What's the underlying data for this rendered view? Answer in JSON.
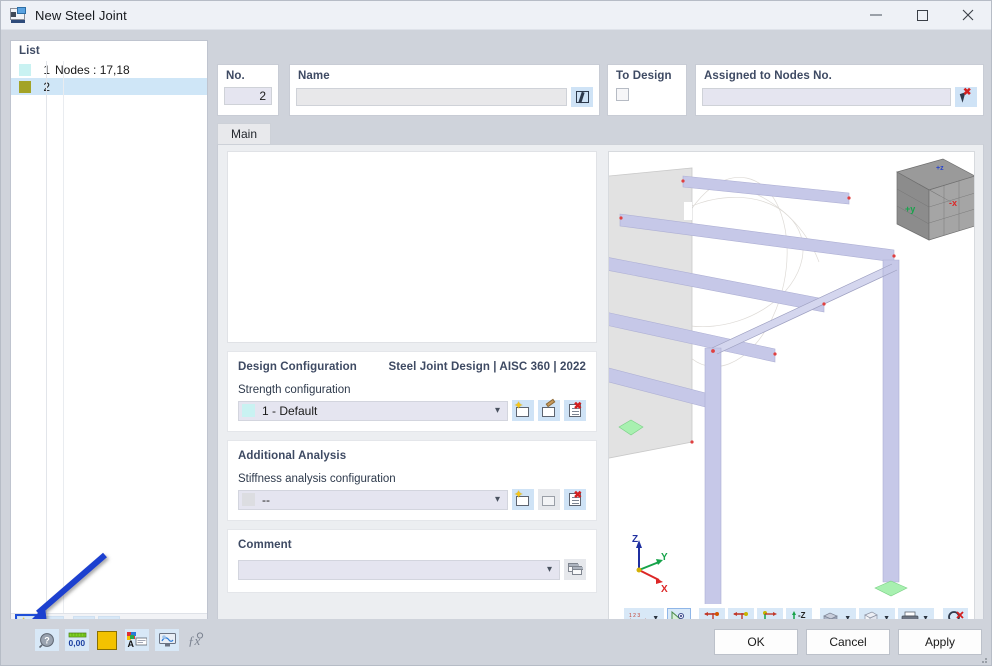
{
  "window": {
    "title": "New Steel Joint",
    "icon": "steel-joint-icon",
    "controls": {
      "minimize": "–",
      "maximize": "☐",
      "close": "✕"
    }
  },
  "list_panel": {
    "header": "List",
    "rows": [
      {
        "index": "1",
        "label": "Nodes : 17,18",
        "color": "#c9f2f2",
        "selected": false
      },
      {
        "index": "2",
        "label": "",
        "color": "#a3a327",
        "selected": true
      }
    ],
    "toolbar": [
      {
        "name": "new-item-button",
        "title": "New",
        "highlighted": true
      },
      {
        "name": "copy-item-button",
        "title": "Copy",
        "highlighted": false
      },
      {
        "name": "select-all-button",
        "title": "Select All",
        "highlighted": false
      },
      {
        "name": "invert-selection-button",
        "title": "Invert Selection",
        "highlighted": false
      }
    ],
    "delete_button": "✕"
  },
  "fields": {
    "no": {
      "label": "No.",
      "value": "2"
    },
    "name": {
      "label": "Name",
      "value": "",
      "placeholder": ""
    },
    "to_design": {
      "label": "To Design",
      "checked": false
    },
    "assigned_nodes": {
      "label": "Assigned to Nodes No.",
      "value": "",
      "placeholder": ""
    }
  },
  "tabs": [
    {
      "label": "Main",
      "active": true
    }
  ],
  "design_configuration": {
    "title": "Design Configuration",
    "standard": "Steel Joint Design | AISC 360 | 2022",
    "field_label": "Strength configuration",
    "value": "1 - Default",
    "swatch": "#c9f2f2",
    "buttons": [
      "new-config-button",
      "edit-config-button",
      "delete-config-button"
    ]
  },
  "additional_analysis": {
    "title": "Additional Analysis",
    "field_label": "Stiffness analysis configuration",
    "value": "--",
    "swatch": "#dcdde1",
    "buttons": [
      "new-stiffness-config-button",
      "edit-stiffness-config-button",
      "delete-stiffness-config-button"
    ]
  },
  "comment": {
    "title": "Comment",
    "value": "",
    "button": "comment-library-button"
  },
  "viewport": {
    "view_cube": {
      "front": "+y",
      "right": "-x"
    },
    "axes": {
      "z": "Z",
      "y": "Y",
      "x": "X"
    },
    "toolbar": [
      {
        "name": "numbering-button",
        "caption": "1 2 3",
        "dropdown": true
      },
      {
        "name": "view-angle-button",
        "caption": "",
        "dropdown": false,
        "active": true
      },
      {
        "name": "view-negative-x-button",
        "caption": "-X",
        "dropdown": false
      },
      {
        "name": "view-y-button",
        "caption": "Y",
        "dropdown": false
      },
      {
        "name": "view-z-button",
        "caption": "Z",
        "dropdown": false
      },
      {
        "name": "view-negative-z-button",
        "caption": "-Z",
        "dropdown": false
      },
      {
        "name": "render-mode-button",
        "caption": "",
        "dropdown": true
      },
      {
        "name": "wireframe-mode-button",
        "caption": "",
        "dropdown": true
      },
      {
        "name": "print-button",
        "caption": "",
        "dropdown": true
      },
      {
        "name": "zoom-reset-button",
        "caption": "",
        "dropdown": false
      }
    ]
  },
  "status_bar": {
    "icons": [
      {
        "name": "help-icon",
        "glyph": "?"
      },
      {
        "name": "number-format-icon",
        "glyph": "0,00"
      },
      {
        "name": "color-swatch-icon",
        "glyph": ""
      },
      {
        "name": "font-label-icon",
        "glyph": "A"
      },
      {
        "name": "display-settings-icon",
        "glyph": ""
      },
      {
        "name": "function-icon",
        "glyph": "ƒx"
      }
    ]
  },
  "footer_buttons": [
    {
      "name": "ok-button",
      "label": "OK"
    },
    {
      "name": "cancel-button",
      "label": "Cancel"
    },
    {
      "name": "apply-button",
      "label": "Apply"
    }
  ],
  "colors": {
    "accent_blue": "#3e4a63",
    "highlight": "#cfe6f7",
    "toolbar_btn": "#d8e8f7",
    "annotation_arrow": "#1f3fcf",
    "member": "#c6c8e8",
    "support": "#a8f0b0"
  }
}
